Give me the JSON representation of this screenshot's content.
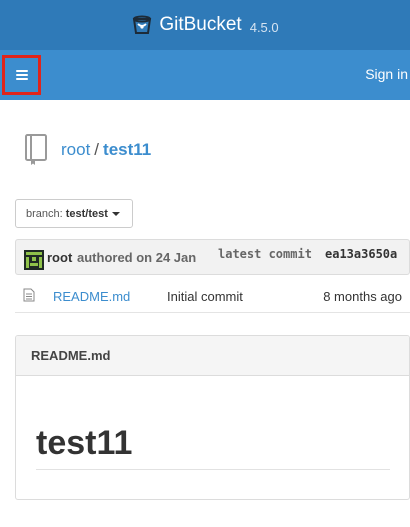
{
  "app": {
    "name": "GitBucket",
    "version": "4.5.0"
  },
  "nav": {
    "sign_in": "Sign in"
  },
  "repo": {
    "owner": "root",
    "separator": "/",
    "name": "test11"
  },
  "branch": {
    "label": "branch:",
    "name": "test/test"
  },
  "commit": {
    "author": "root",
    "meta": "authored on 24 Jan",
    "latest_label": "latest commit",
    "hash": "ea13a3650a"
  },
  "files": [
    {
      "name": "README.md",
      "message": "Initial commit",
      "age": "8 months ago"
    }
  ],
  "readme": {
    "heading": "README.md",
    "title": "test11"
  },
  "colors": {
    "header": "#2f7ab8",
    "navbar": "#3c8dce",
    "highlight": "#e0241b",
    "link": "#3c8dce"
  },
  "icons": {
    "brand": "gitbucket-logo-icon",
    "menu": "hamburger-menu-icon",
    "repo": "repository-book-icon",
    "avatar": "user-avatar-icon",
    "file": "file-text-icon",
    "caret": "caret-down-icon"
  }
}
